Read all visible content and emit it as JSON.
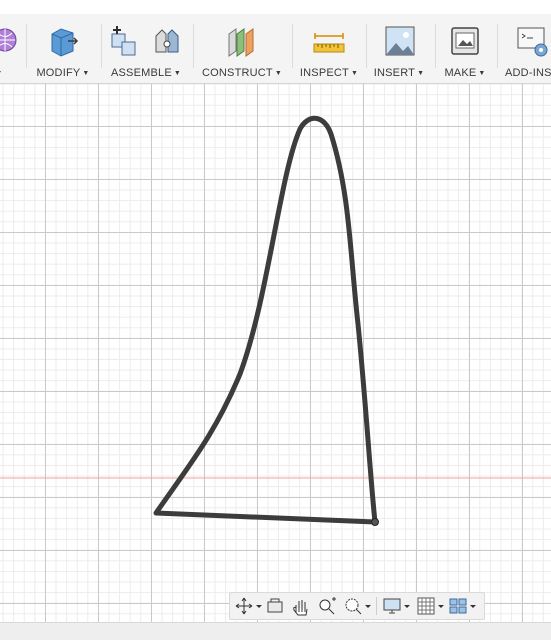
{
  "toolbar": {
    "groups": [
      {
        "label": ""
      },
      {
        "label": "MODIFY"
      },
      {
        "label": "ASSEMBLE"
      },
      {
        "label": "CONSTRUCT"
      },
      {
        "label": "INSPECT"
      },
      {
        "label": "INSERT"
      },
      {
        "label": "MAKE"
      },
      {
        "label": "ADD-INS"
      }
    ]
  },
  "icons": {
    "create": "create-form-icon",
    "modify": "press-pull-icon",
    "new_component": "new-component-icon",
    "joint": "joint-icon",
    "offset_plane": "offset-plane-icon",
    "measure": "measure-icon",
    "insert_image": "insert-image-icon",
    "make_3d_print": "3d-print-icon",
    "scripts": "scripts-addins-icon"
  },
  "nav": {
    "items": [
      "orbit-icon",
      "look-at-icon",
      "pan-icon",
      "zoom-icon",
      "fit-icon",
      "display-settings-icon",
      "grid-settings-icon",
      "viewports-icon"
    ]
  },
  "colors": {
    "sketch_stroke": "#3c3c3c",
    "axis_red": "#f0a0a0",
    "grid_major": "#c9c9c9",
    "grid_minor": "#ececec"
  }
}
